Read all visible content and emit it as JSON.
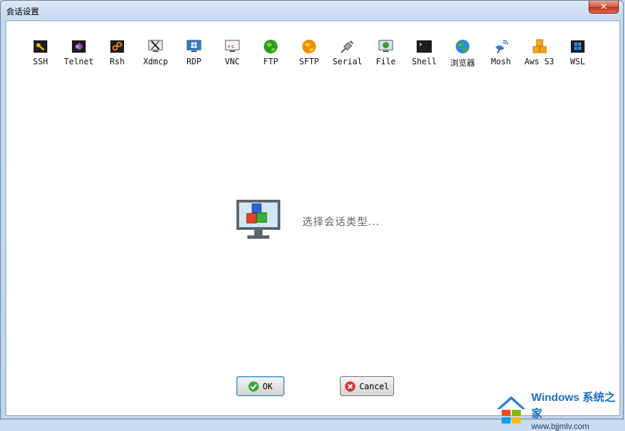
{
  "window": {
    "title": "会话设置",
    "close_glyph": "✕"
  },
  "session_types": [
    {
      "label": "SSH",
      "icon": "key-icon"
    },
    {
      "label": "Telnet",
      "icon": "telnet-icon"
    },
    {
      "label": "Rsh",
      "icon": "rsh-icon"
    },
    {
      "label": "Xdmcp",
      "icon": "xdmcp-icon"
    },
    {
      "label": "RDP",
      "icon": "rdp-icon"
    },
    {
      "label": "VNC",
      "icon": "vnc-icon"
    },
    {
      "label": "FTP",
      "icon": "ftp-globe-icon"
    },
    {
      "label": "SFTP",
      "icon": "sftp-globe-icon"
    },
    {
      "label": "Serial",
      "icon": "serial-plug-icon"
    },
    {
      "label": "File",
      "icon": "file-monitor-icon"
    },
    {
      "label": "Shell",
      "icon": "shell-terminal-icon"
    },
    {
      "label": "浏览器",
      "icon": "browser-globe-icon"
    },
    {
      "label": "Mosh",
      "icon": "mosh-satellite-icon"
    },
    {
      "label": "Aws S3",
      "icon": "aws-cubes-icon"
    },
    {
      "label": "WSL",
      "icon": "wsl-windows-icon"
    }
  ],
  "placeholder": {
    "text": "选择会话类型..."
  },
  "buttons": {
    "ok": "OK",
    "cancel": "Cancel"
  },
  "watermark": {
    "brand": "Windows",
    "brand_cn": "系统之家",
    "url": "www.bjjmlv.com"
  },
  "colors": {
    "accent": "#3c7fb1",
    "close": "#c0341b",
    "frame": "#c6d9ee"
  }
}
